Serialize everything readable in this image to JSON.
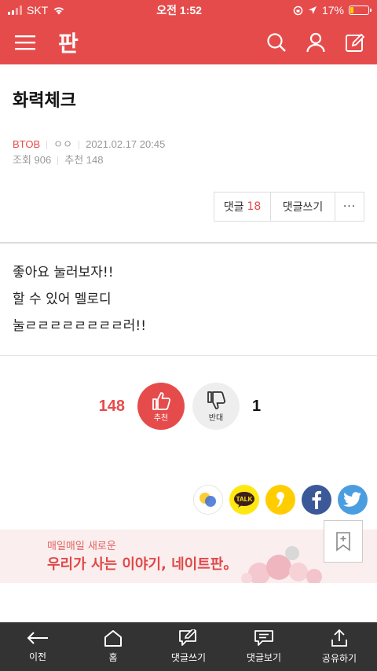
{
  "status": {
    "carrier": "SKT",
    "time": "오전 1:52",
    "battery_pct_label": "17%",
    "battery_level": 0.17,
    "battery_color": "#ffd400"
  },
  "header": {
    "logo": "판",
    "brand_color": "#e64b4b"
  },
  "post": {
    "title": "화력체크",
    "author": "BTOB",
    "author_extra": "ㅇㅇ",
    "date": "2021.02.17 20:45",
    "views_label": "조회",
    "views": "906",
    "recommend_label": "추천",
    "recommend": "148",
    "body_lines": [
      "좋아요 눌러보자!!",
      "할 수 있어 멜로디",
      "눌ㄹㄹㄹㄹㄹㄹㄹㄹ러!!"
    ]
  },
  "actions": {
    "comments_label": "댓글",
    "comments_count": "18",
    "write_label": "댓글쓰기",
    "more_label": "···"
  },
  "vote": {
    "up_count": "148",
    "up_label": "추천",
    "down_label": "반대",
    "down_count": "1"
  },
  "share": {
    "icons": [
      "band-icon",
      "kakaotalk-icon",
      "kakaostory-icon",
      "facebook-icon",
      "twitter-icon"
    ],
    "talk_label": "TALK"
  },
  "banner": {
    "line1": "매일매일 새로운",
    "line2": "우리가 사는 이야기, 네이트판。"
  },
  "bottom_nav": {
    "items": [
      "이전",
      "홈",
      "댓글쓰기",
      "댓글보기",
      "공유하기"
    ]
  }
}
